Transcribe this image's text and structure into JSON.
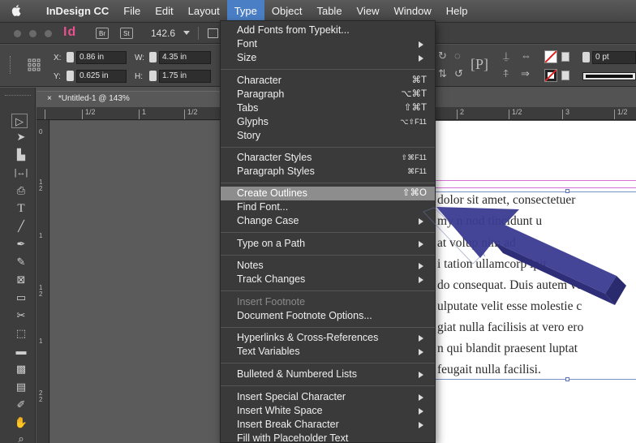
{
  "menubar": {
    "items": [
      "InDesign CC",
      "File",
      "Edit",
      "Layout",
      "Type",
      "Object",
      "Table",
      "View",
      "Window",
      "Help"
    ]
  },
  "appbar": {
    "app_logo": "Id",
    "bridge_badge": "Br",
    "stock_badge": "St",
    "zoom_value": "142.6"
  },
  "control": {
    "x_label": "X:",
    "x_value": "0.86 in",
    "y_label": "Y:",
    "y_value": "0.625 in",
    "w_label": "W:",
    "w_value": "4.35 in",
    "h_label": "H:",
    "h_value": "1.75 in",
    "stroke_value": "0 pt"
  },
  "document": {
    "tab_title": "*Untitled-1 @ 143%",
    "ruler_labels": [
      "1/2",
      "1",
      "1/2",
      "2",
      "1/2",
      "3",
      "1/2"
    ],
    "vruler_labels": [
      "0",
      "1",
      "2",
      "1",
      "1",
      "2",
      "1",
      "2",
      "2",
      "1",
      "2"
    ],
    "body_lines": [
      "dolor sit amet, consectetuer",
      "my n          nod tincidunt u",
      "at volup         nim ad",
      "i tation ullamcorp        ipit",
      "do consequat. Duis autem ve",
      "ulputate velit esse molestie c",
      "giat nulla facilisis at vero ero",
      "n qui blandit praesent luptat",
      "feugait nulla facilisi."
    ]
  },
  "type_menu": {
    "items": [
      {
        "label": "Add Fonts from Typekit...",
        "shortcut": "",
        "submenu": false
      },
      {
        "label": "Font",
        "shortcut": "",
        "submenu": true
      },
      {
        "label": "Size",
        "shortcut": "",
        "submenu": true
      },
      {
        "label": "Character",
        "shortcut": "⌘T",
        "submenu": false
      },
      {
        "label": "Paragraph",
        "shortcut": "⌥⌘T",
        "submenu": false
      },
      {
        "label": "Tabs",
        "shortcut": "⇧⌘T",
        "submenu": false
      },
      {
        "label": "Glyphs",
        "shortcut": "⌥⇧F11",
        "submenu": false
      },
      {
        "label": "Story",
        "shortcut": "",
        "submenu": false
      },
      {
        "label": "Character Styles",
        "shortcut": "⇧⌘F11",
        "submenu": false
      },
      {
        "label": "Paragraph Styles",
        "shortcut": "⌘F11",
        "submenu": false
      },
      {
        "label": "Create Outlines",
        "shortcut": "⇧⌘O",
        "submenu": false
      },
      {
        "label": "Find Font...",
        "shortcut": "",
        "submenu": false
      },
      {
        "label": "Change Case",
        "shortcut": "",
        "submenu": true
      },
      {
        "label": "Type on a Path",
        "shortcut": "",
        "submenu": true
      },
      {
        "label": "Notes",
        "shortcut": "",
        "submenu": true
      },
      {
        "label": "Track Changes",
        "shortcut": "",
        "submenu": true
      },
      {
        "label": "Insert Footnote",
        "shortcut": "",
        "submenu": false
      },
      {
        "label": "Document Footnote Options...",
        "shortcut": "",
        "submenu": false
      },
      {
        "label": "Hyperlinks & Cross-References",
        "shortcut": "",
        "submenu": true
      },
      {
        "label": "Text Variables",
        "shortcut": "",
        "submenu": true
      },
      {
        "label": "Bulleted & Numbered Lists",
        "shortcut": "",
        "submenu": true
      },
      {
        "label": "Insert Special Character",
        "shortcut": "",
        "submenu": true
      },
      {
        "label": "Insert White Space",
        "shortcut": "",
        "submenu": true
      },
      {
        "label": "Insert Break Character",
        "shortcut": "",
        "submenu": true
      },
      {
        "label": "Fill with Placeholder Text",
        "shortcut": "",
        "submenu": false
      }
    ],
    "highlighted_index": 10,
    "disabled_index": 16
  },
  "colors": {
    "menubar_active": "#4a7fc6",
    "menu_highlight": "#8d8d8d",
    "annotation_arrow": "#3a3a8c",
    "indesign_pink": "#e8518f"
  }
}
